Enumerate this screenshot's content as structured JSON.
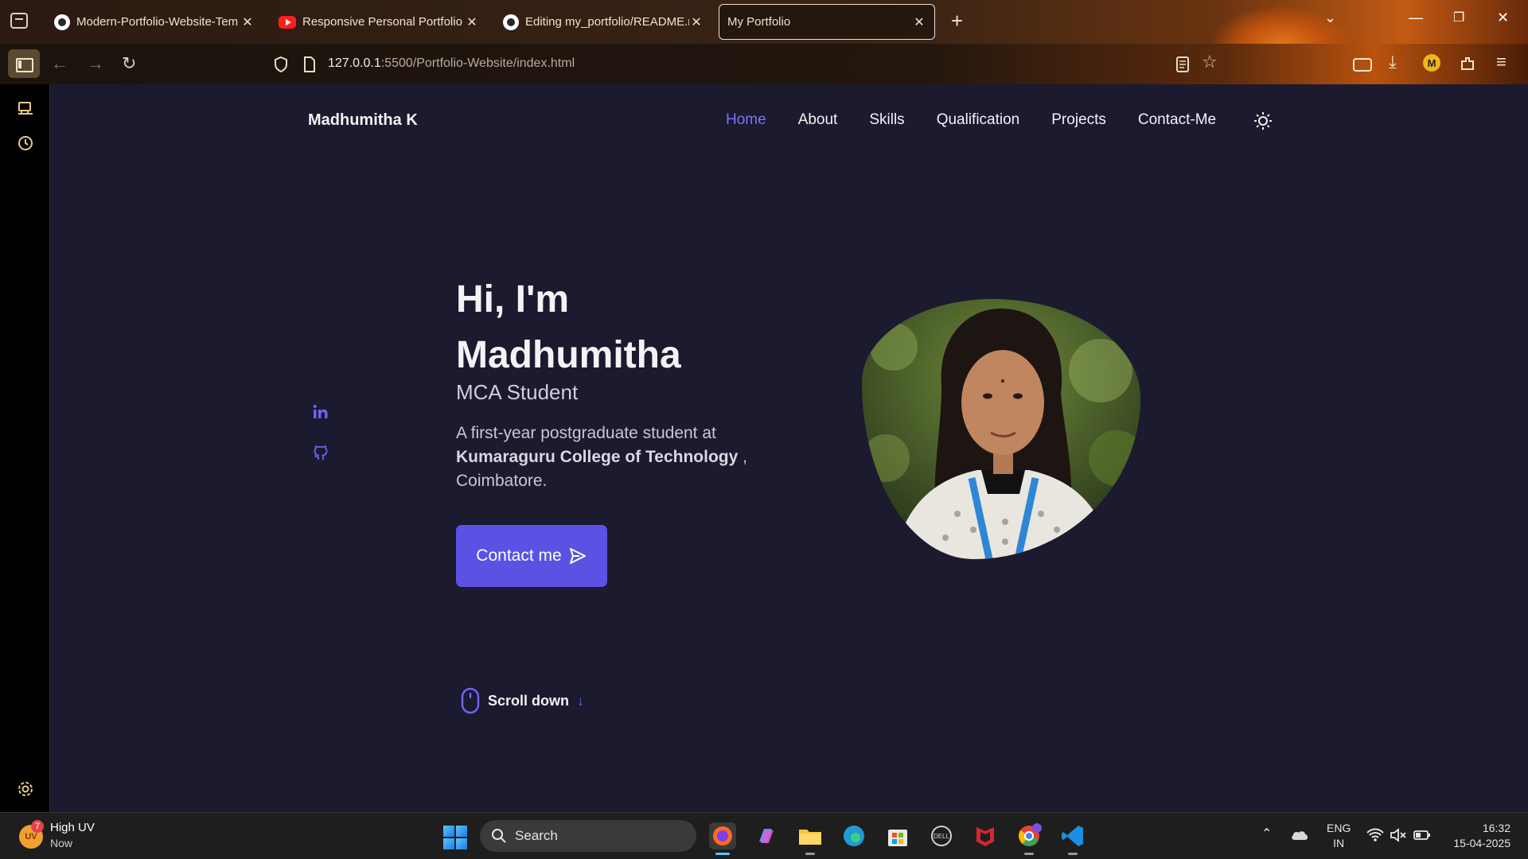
{
  "browser": {
    "tabs": [
      {
        "title": "Modern-Portfolio-Website-Tem",
        "favicon": "github-icon",
        "active": false
      },
      {
        "title": "Responsive Personal Portfolio W",
        "favicon": "youtube-icon",
        "active": false
      },
      {
        "title": "Editing my_portfolio/README.m",
        "favicon": "github-icon",
        "active": false
      },
      {
        "title": "My Portfolio",
        "favicon": "",
        "active": true
      }
    ],
    "url_host": "127.0.0.1",
    "url_rest": ":5500/Portfolio-Website/index.html"
  },
  "site": {
    "logo": "Madhumitha K",
    "nav": [
      "Home",
      "About",
      "Skills",
      "Qualification",
      "Projects",
      "Contact-Me"
    ],
    "active_nav": "Home",
    "hero": {
      "greeting": "Hi, I'm",
      "name": "Madhumitha",
      "subtitle": "MCA Student",
      "desc_prefix": "A first-year postgraduate student at",
      "desc_bold": "Kumaraguru College of Technology",
      "desc_suffix": " , Coimbatore.",
      "cta_label": "Contact me"
    },
    "social_icons": [
      "linkedin-icon",
      "github-icon"
    ],
    "scroll_label": "Scroll down"
  },
  "taskbar": {
    "weather_title": "High UV",
    "weather_time": "Now",
    "weather_badge": "7",
    "weather_avatar": "UV",
    "search_placeholder": "Search",
    "lang_line1": "ENG",
    "lang_line2": "IN",
    "time": "16:32",
    "date": "15-04-2025"
  },
  "colors": {
    "accent": "#5b52e4",
    "page_bg": "#1b1a2e",
    "active_nav": "#7b74f5"
  }
}
